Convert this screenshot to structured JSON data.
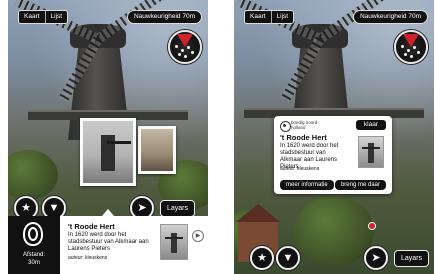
{
  "screens": {
    "left": {
      "view_toggle": [
        "Kaart",
        "Lijst"
      ],
      "accuracy": "Nauwkeurigheid 70m",
      "layars_label": "Layars",
      "info": {
        "distance_label": "Afstand:",
        "distance_value": "30m",
        "title": "'t Roode Hert",
        "description": "In 1620 werd door het stadsbestuur van Alkmaar aan Laurens Pieters",
        "author": "auteur: kleuskens"
      },
      "icons": [
        "star-icon",
        "filter-icon",
        "bird-icon",
        "fingerprint-icon",
        "play-icon",
        "radar-icon"
      ]
    },
    "right": {
      "view_toggle": [
        "Kaart",
        "Lijst"
      ],
      "accuracy": "Nauwkeurigheid 70m",
      "layars_label": "Layars",
      "card": {
        "brand": "bnedig noord-holland",
        "close_label": "klaar",
        "title": "'t Roode Hert",
        "description": "In 1620 werd door het stadsbestuur van Alkmaar aan Laurens Pieters",
        "author": "auteur: kleuskens",
        "more_info_label": "meer informatie",
        "take_me_label": "breng me daar"
      }
    }
  },
  "colors": {
    "accent_red": "#d0202a",
    "control_dark": "#111111"
  }
}
